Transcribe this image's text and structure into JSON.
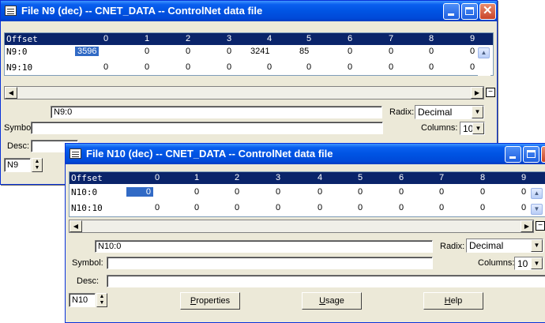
{
  "window_n9": {
    "title": "File N9 (dec) -- CNET_DATA -- ControlNet data file",
    "header": {
      "offset": "Offset",
      "cols": [
        "0",
        "1",
        "2",
        "3",
        "4",
        "5",
        "6",
        "7",
        "8",
        "9"
      ]
    },
    "rows": [
      {
        "label": "N9:0",
        "values": [
          "3596",
          "0",
          "0",
          "0",
          "3241",
          "85",
          "0",
          "0",
          "0",
          "0"
        ]
      },
      {
        "label": "N9:10",
        "values": [
          "0",
          "0",
          "0",
          "0",
          "0",
          "0",
          "0",
          "0",
          "0",
          "0"
        ]
      }
    ],
    "address_value": "N9:0",
    "radix_label": "Radix:",
    "radix_value": "Decimal",
    "symbol_label": "Symbol:",
    "columns_label": "Columns:",
    "columns_value": "10",
    "desc_label": "Desc:",
    "file_value": "N9"
  },
  "window_n10": {
    "title": "File N10 (dec) -- CNET_DATA -- ControlNet data file",
    "header": {
      "offset": "Offset",
      "cols": [
        "0",
        "1",
        "2",
        "3",
        "4",
        "5",
        "6",
        "7",
        "8",
        "9"
      ]
    },
    "rows": [
      {
        "label": "N10:0",
        "values": [
          "0",
          "0",
          "0",
          "0",
          "0",
          "0",
          "0",
          "0",
          "0",
          "0"
        ]
      },
      {
        "label": "N10:10",
        "values": [
          "0",
          "0",
          "0",
          "0",
          "0",
          "0",
          "0",
          "0",
          "0",
          "0"
        ]
      }
    ],
    "address_value": "N10:0",
    "radix_label": "Radix:",
    "radix_value": "Decimal",
    "symbol_label": "Symbol:",
    "columns_label": "Columns:",
    "columns_value": "10",
    "desc_label": "Desc:",
    "file_value": "N10",
    "buttons": {
      "properties_pre": "",
      "properties_key": "P",
      "properties_rest": "roperties",
      "usage_key": "U",
      "usage_rest": "sage",
      "help_key": "H",
      "help_rest": "elp"
    }
  },
  "colors": {
    "title_blue": "#0054e3",
    "header_navy": "#0a246a",
    "selection": "#316ac5",
    "face": "#ece9d8"
  },
  "icons": [
    "data-file-icon",
    "minimize-icon",
    "maximize-icon",
    "close-icon",
    "scroll-up-icon",
    "scroll-down-icon",
    "scroll-left-icon",
    "scroll-right-icon",
    "dropdown-arrow-icon",
    "spin-arrows-icon"
  ]
}
